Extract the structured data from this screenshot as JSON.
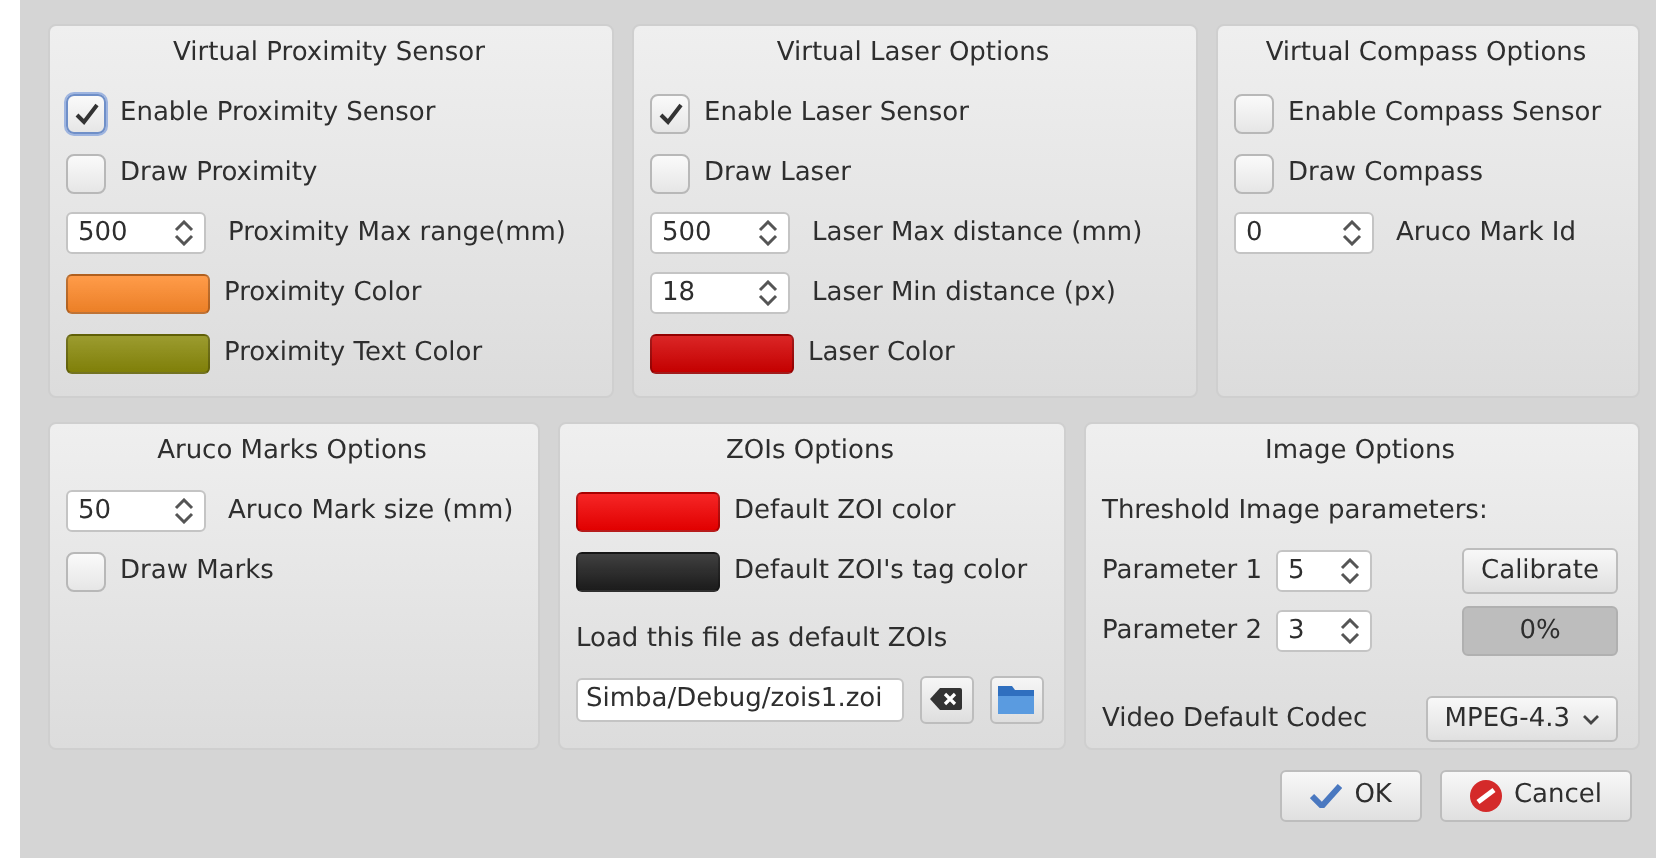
{
  "rows": [
    {
      "panels": [
        {
          "title": "Virtual Proximity Sensor",
          "items": [
            {
              "kind": "checkbox",
              "label": "Enable Proximity Sensor",
              "checked": true,
              "focused": true
            },
            {
              "kind": "checkbox",
              "label": "Draw Proximity",
              "checked": false
            },
            {
              "kind": "spin",
              "number": "500",
              "label": "Proximity Max range(mm)"
            },
            {
              "kind": "color",
              "color": "#ff8a2a",
              "label": "Proximity Color"
            },
            {
              "kind": "color",
              "color": "#8a8a0a",
              "label": "Proximity Text Color"
            }
          ]
        },
        {
          "title": "Virtual Laser Options",
          "items": [
            {
              "kind": "checkbox",
              "label": "Enable Laser Sensor",
              "checked": true
            },
            {
              "kind": "checkbox",
              "label": "Draw Laser",
              "checked": false
            },
            {
              "kind": "spin",
              "number": "500",
              "label": "Laser Max distance (mm)"
            },
            {
              "kind": "spin",
              "number": "18",
              "label": "Laser Min distance (px)"
            },
            {
              "kind": "color",
              "color": "#d40000",
              "label": "Laser Color"
            }
          ]
        },
        {
          "title": "Virtual Compass Options",
          "items": [
            {
              "kind": "checkbox",
              "label": "Enable Compass Sensor",
              "checked": false
            },
            {
              "kind": "checkbox",
              "label": "Draw Compass",
              "checked": false
            },
            {
              "kind": "spin",
              "number": "0",
              "label": "Aruco Mark Id"
            }
          ]
        }
      ]
    },
    {
      "panels": [
        {
          "title": "Aruco Marks Options",
          "items": [
            {
              "kind": "spin",
              "number": "50",
              "label": "Aruco Mark size (mm)"
            },
            {
              "kind": "checkbox",
              "label": "Draw Marks",
              "checked": false
            }
          ]
        },
        {
          "title": "ZOIs Options",
          "items": [
            {
              "kind": "color",
              "color": "#f40000",
              "label": "Default ZOI color"
            },
            {
              "kind": "color",
              "color": "#1e1e1e",
              "label": "Default ZOI's tag color"
            },
            {
              "kind": "text",
              "label": "Load this file as default ZOIs"
            },
            {
              "kind": "file",
              "value": "Simba/Debug/zois1.zoi"
            }
          ]
        },
        {
          "title": "Image Options",
          "items": [
            {
              "kind": "text",
              "label": "Threshold Image parameters:"
            },
            {
              "kind": "param",
              "label": "Parameter 1",
              "value": "5",
              "side": {
                "kind": "button",
                "label": "Calibrate"
              }
            },
            {
              "kind": "param",
              "label": "Parameter 2",
              "value": "3",
              "side": {
                "kind": "progress",
                "label": "0%",
                "level": 0
              }
            },
            {
              "kind": "select",
              "label": "Video Default Codec",
              "value": "MPEG-4.3"
            }
          ]
        }
      ]
    }
  ],
  "buttons": [
    {
      "kind": "ok",
      "label": "OK"
    },
    {
      "kind": "cancel",
      "label": "Cancel"
    }
  ]
}
